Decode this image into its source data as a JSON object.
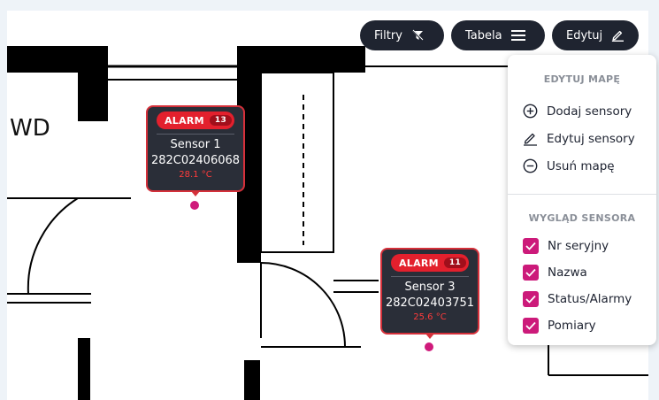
{
  "toolbar": {
    "filters_label": "Filtry",
    "table_label": "Tabela",
    "edit_label": "Edytuj"
  },
  "map": {
    "room_label": "WD",
    "sensors": [
      {
        "alarm_label": "ALARM",
        "alarm_count": "13",
        "name": "Sensor 1",
        "serial": "282C02406068",
        "temperature": "28.1 °C"
      },
      {
        "alarm_label": "ALARM",
        "alarm_count": "11",
        "name": "Sensor 3",
        "serial": "282C02403751",
        "temperature": "25.6 °C"
      }
    ]
  },
  "edit_panel": {
    "edit_map_header": "EDYTUJ MAPĘ",
    "actions": [
      {
        "label": "Dodaj sensory",
        "icon": "plus-circle-icon"
      },
      {
        "label": "Edytuj sensory",
        "icon": "pencil-icon"
      },
      {
        "label": "Usuń mapę",
        "icon": "minus-circle-icon"
      }
    ],
    "sensor_view_header": "WYGLĄD SENSORA",
    "options": [
      {
        "label": "Nr seryjny",
        "checked": true
      },
      {
        "label": "Nazwa",
        "checked": true
      },
      {
        "label": "Status/Alarmy",
        "checked": true
      },
      {
        "label": "Pomiary",
        "checked": true
      }
    ]
  },
  "colors": {
    "toolbar_bg": "#1f2430",
    "alarm_red": "#e3202d",
    "checkbox_magenta": "#cc1a7a",
    "pin_magenta": "#cf1a7b"
  }
}
